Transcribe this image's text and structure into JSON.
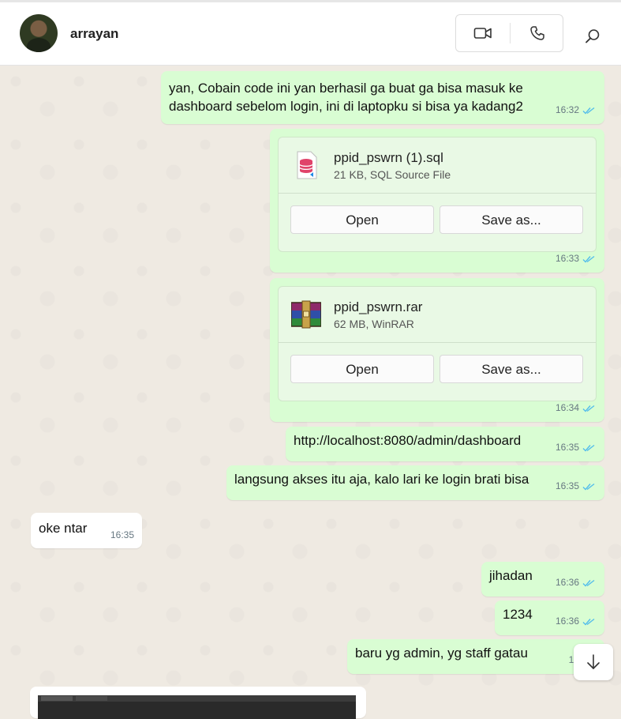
{
  "header": {
    "contact_name": "arrayan",
    "video_icon": "video-camera-icon",
    "call_icon": "phone-icon",
    "search_icon": "search-icon"
  },
  "messages": [
    {
      "direction": "out",
      "line1": "yan, Cobain code ini yan berhasil ga buat ga bisa masuk ke",
      "line2": "dashboard sebelom login, ini di laptopku si bisa ya kadang2",
      "time": "16:32"
    },
    {
      "direction": "out",
      "type": "file",
      "file_name": "ppid_pswrn (1).sql",
      "file_info": "21 KB, SQL Source File",
      "open_label": "Open",
      "save_label": "Save as...",
      "time": "16:33",
      "icon": "sql-file-icon"
    },
    {
      "direction": "out",
      "type": "file",
      "file_name": "ppid_pswrn.rar",
      "file_info": "62 MB, WinRAR",
      "open_label": "Open",
      "save_label": "Save as...",
      "time": "16:34",
      "icon": "winrar-archive-icon"
    },
    {
      "direction": "out",
      "text": "http://localhost:8080/admin/dashboard",
      "time": "16:35"
    },
    {
      "direction": "out",
      "text": "langsung akses itu aja, kalo lari ke login brati bisa",
      "time": "16:35"
    },
    {
      "direction": "in",
      "text": "oke ntar",
      "time": "16:35"
    },
    {
      "direction": "out",
      "text": "jihadan",
      "time": "16:36"
    },
    {
      "direction": "out",
      "text": "1234",
      "time": "16:36"
    },
    {
      "direction": "out",
      "text": "baru yg admin, yg staff gatau",
      "time": "16:3"
    }
  ],
  "colors": {
    "outgoing_bubble": "#d9fdd3",
    "incoming_bubble": "#ffffff",
    "read_ticks": "#53bdeb",
    "chat_background": "#efeae2"
  },
  "scroll_down_icon": "arrow-down-icon"
}
